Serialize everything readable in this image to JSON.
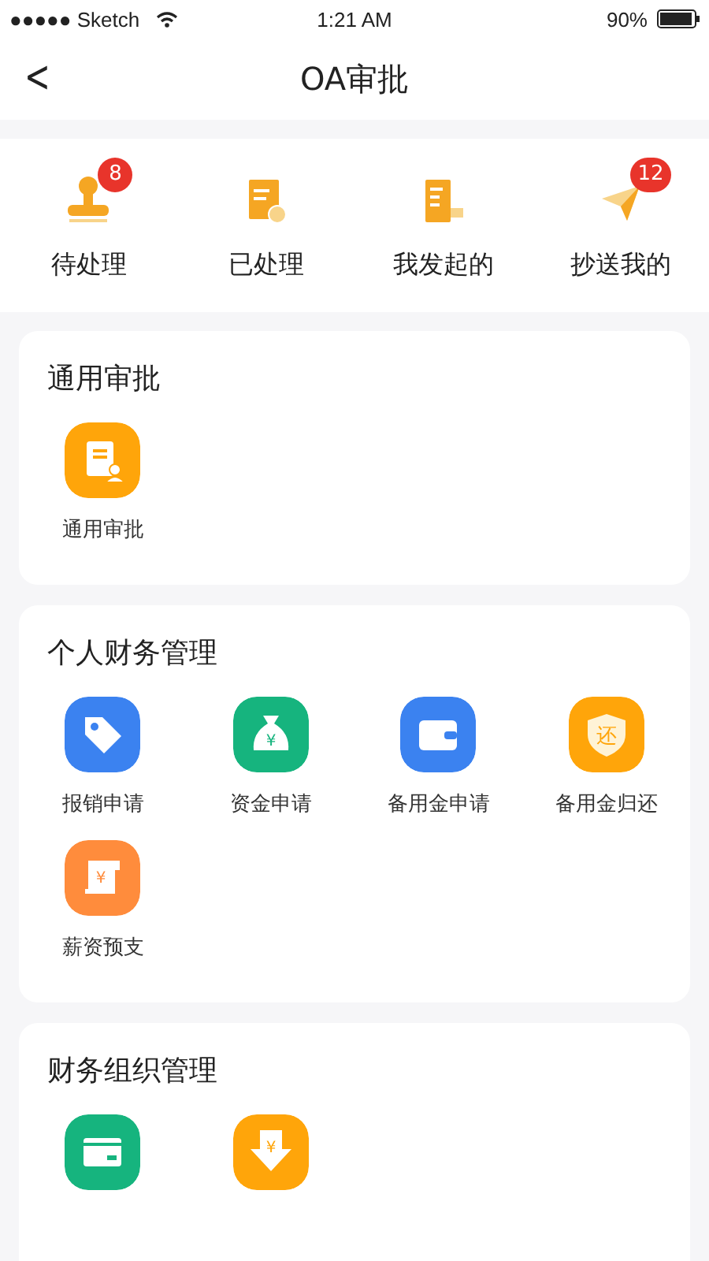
{
  "status_bar": {
    "carrier": "●●●●● Sketch",
    "time": "1:21 AM",
    "battery": "90%"
  },
  "nav": {
    "back": "<",
    "title": "OA审批"
  },
  "summary": [
    {
      "label": "待处理",
      "kind": "stamp",
      "badge": "8"
    },
    {
      "label": "已处理",
      "kind": "doc-check"
    },
    {
      "label": "我发起的",
      "kind": "doc-flag"
    },
    {
      "label": "抄送我的",
      "kind": "plane",
      "badge": "12"
    }
  ],
  "sections": [
    {
      "title": "通用审批",
      "items": [
        {
          "label": "通用审批",
          "kind": "doc-person",
          "color": "#ffa50a"
        }
      ]
    },
    {
      "title": "个人财务管理",
      "items": [
        {
          "label": "报销申请",
          "kind": "tag",
          "color": "#3b82f0"
        },
        {
          "label": "资金申请",
          "kind": "money-bag",
          "color": "#16b47e",
          "glyph": "¥"
        },
        {
          "label": "备用金申请",
          "kind": "wallet",
          "color": "#3b82f0"
        },
        {
          "label": "备用金归还",
          "kind": "shield",
          "color": "#ffa50a",
          "glyph": "还"
        },
        {
          "label": "薪资预支",
          "kind": "receipt",
          "color": "#ff8c3c",
          "glyph": "¥"
        }
      ]
    },
    {
      "title": "财务组织管理",
      "items": [
        {
          "kind": "card",
          "color": "#16b47e"
        },
        {
          "kind": "download",
          "color": "#ffa50a",
          "glyph": "¥"
        }
      ]
    }
  ]
}
